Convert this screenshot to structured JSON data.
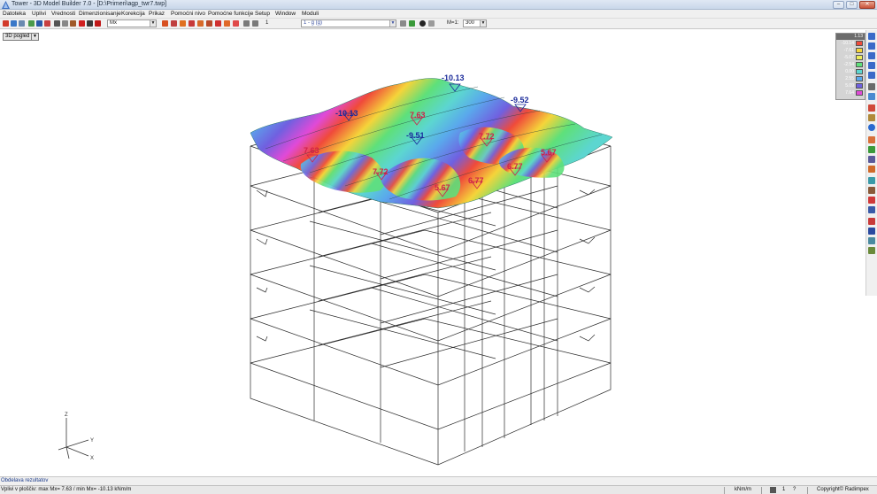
{
  "window": {
    "title": "Tower - 3D Model Builder 7.0 - [D:\\Primeri\\agp_twr7.twp]",
    "controls": {
      "minimize": "–",
      "maximize": "□",
      "close": "✕"
    }
  },
  "menu": [
    "Datoteka",
    "Uplivi",
    "Vrednosti",
    "Dimenzionisanje",
    "Korekcija",
    "Prikaz",
    "Pomoćni nivo",
    "Pomoćne funkcije",
    "Setup",
    "Window",
    "Moduli"
  ],
  "toolbar": {
    "result_combo": "Mx",
    "level_combo": "1 - g (g)",
    "scale_label": "M=1:",
    "scale_combo": "300",
    "page_value": "1"
  },
  "viewport": {
    "view_select": "3D pogled",
    "axis_labels": {
      "x": "X",
      "y": "Y",
      "z": "Z"
    },
    "value_labels": [
      {
        "text": "-10.13",
        "kind": "min"
      },
      {
        "text": "-10.13",
        "kind": "min"
      },
      {
        "text": "-9.52",
        "kind": "min"
      },
      {
        "text": "-9.51",
        "kind": "min"
      },
      {
        "text": "7.63",
        "kind": "max"
      },
      {
        "text": "7.63",
        "kind": "max"
      },
      {
        "text": "7.72",
        "kind": "max"
      },
      {
        "text": "7.72",
        "kind": "max"
      },
      {
        "text": "5.67",
        "kind": "max"
      },
      {
        "text": "5.67",
        "kind": "max"
      },
      {
        "text": "6.77",
        "kind": "max"
      },
      {
        "text": "6.77",
        "kind": "max"
      }
    ]
  },
  "legend": {
    "header": "1.13",
    "items": [
      {
        "value": "-10.14",
        "color": "#f04a3a"
      },
      {
        "value": "-7.61",
        "color": "#f5d43a"
      },
      {
        "value": "-5.07",
        "color": "#ecec5a"
      },
      {
        "value": "-2.54",
        "color": "#5ee07a"
      },
      {
        "value": "0.00",
        "color": "#5cd6d0"
      },
      {
        "value": "2.55",
        "color": "#5aa8ec"
      },
      {
        "value": "5.09",
        "color": "#7060e0"
      },
      {
        "value": "7.64",
        "color": "#e04ad8"
      }
    ]
  },
  "status": {
    "line1": "Obdelava rezultatov",
    "line2": "Vplivi v ploščiv: max Mx= 7.63 / min Mx= -10.13 kNm/m",
    "units": "kNm/m",
    "page": "1",
    "help": "?",
    "copyright": "Copyright© Radimpex"
  },
  "colors": {
    "min_label": "#1a2a9a",
    "max_label": "#d0204a",
    "wireframe": "#2a2a2a"
  }
}
